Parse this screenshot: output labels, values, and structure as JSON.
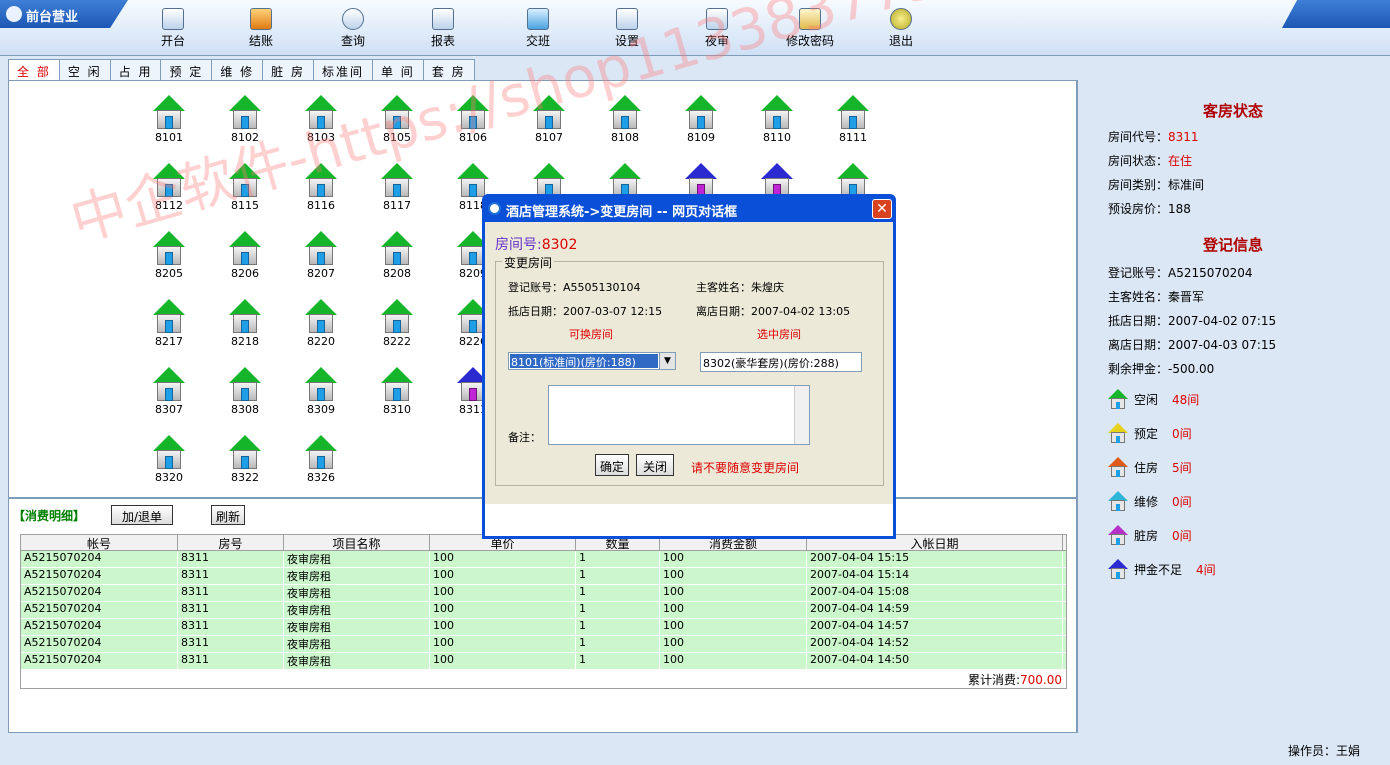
{
  "app": {
    "title": "前台营业"
  },
  "toolbar": {
    "buttons": [
      {
        "label": "开台"
      },
      {
        "label": "结账"
      },
      {
        "label": "查询"
      },
      {
        "label": "报表"
      },
      {
        "label": "交班"
      },
      {
        "label": "设置"
      },
      {
        "label": "夜审"
      },
      {
        "label": "修改密码"
      },
      {
        "label": "退出"
      }
    ]
  },
  "tabs": [
    "全 部",
    "空 闲",
    "占 用",
    "预 定",
    "维 修",
    "脏 房",
    "标准间",
    "单 间",
    "套 房"
  ],
  "rooms": [
    {
      "no": "8101",
      "s": "free"
    },
    {
      "no": "8102",
      "s": "free"
    },
    {
      "no": "8103",
      "s": "free"
    },
    {
      "no": "8105",
      "s": "free"
    },
    {
      "no": "8106",
      "s": "free"
    },
    {
      "no": "8107",
      "s": "free"
    },
    {
      "no": "8108",
      "s": "free"
    },
    {
      "no": "8109",
      "s": "free"
    },
    {
      "no": "8110",
      "s": "free"
    },
    {
      "no": "8111",
      "s": "free"
    },
    {
      "no": "8112",
      "s": "free"
    },
    {
      "no": "8115",
      "s": "free"
    },
    {
      "no": "8116",
      "s": "free"
    },
    {
      "no": "8117",
      "s": "free"
    },
    {
      "no": "8118",
      "s": "free"
    },
    {
      "no": "",
      "s": "free"
    },
    {
      "no": "",
      "s": "free"
    },
    {
      "no": "",
      "s": "dirty"
    },
    {
      "no": "",
      "s": "dirty"
    },
    {
      "no": "",
      "s": "free"
    },
    {
      "no": "8205",
      "s": "free"
    },
    {
      "no": "8206",
      "s": "free"
    },
    {
      "no": "8207",
      "s": "free"
    },
    {
      "no": "8208",
      "s": "free"
    },
    {
      "no": "8209",
      "s": "free"
    },
    {
      "no": "8217",
      "s": "free"
    },
    {
      "no": "8218",
      "s": "free"
    },
    {
      "no": "8220",
      "s": "free"
    },
    {
      "no": "8222",
      "s": "free"
    },
    {
      "no": "8226",
      "s": "free"
    },
    {
      "no": "8307",
      "s": "free"
    },
    {
      "no": "8308",
      "s": "free"
    },
    {
      "no": "8309",
      "s": "free"
    },
    {
      "no": "8310",
      "s": "free"
    },
    {
      "no": "8311",
      "s": "dirty"
    },
    {
      "no": "8320",
      "s": "free"
    },
    {
      "no": "8322",
      "s": "free"
    },
    {
      "no": "8326",
      "s": "free"
    }
  ],
  "room_status": {
    "title": "客房状态",
    "room_code_label": "房间代号：",
    "room_code": "8311",
    "status_label": "房间状态：",
    "status": "在住",
    "type_label": "房间类别：",
    "type": "标准间",
    "price_label": "预设房价：",
    "price": "188"
  },
  "register_info": {
    "title": "登记信息",
    "account": "登记账号：A5215070204",
    "guest": "主客姓名：秦晋军",
    "arrive": "抵店日期：2007-04-02 07:15",
    "leave": "离店日期：2007-04-03 07:15",
    "deposit": "剩余押金：-500.00"
  },
  "legend": [
    {
      "label": "空闲",
      "count": "48间",
      "color": "#15b52a"
    },
    {
      "label": "预定",
      "count": "0间",
      "color": "#e6d21a"
    },
    {
      "label": "住房",
      "count": "5间",
      "color": "#e05a1a"
    },
    {
      "label": "维修",
      "count": "0间",
      "color": "#2fb5d8"
    },
    {
      "label": "脏房",
      "count": "0间",
      "color": "#b530c8"
    },
    {
      "label": "押金不足",
      "count": "4间",
      "color": "#2a2ad0"
    }
  ],
  "consumption": {
    "label": "【消费明细】",
    "add_btn": "加/退单",
    "refresh_btn": "刷新",
    "headers": [
      "帐号",
      "房号",
      "项目名称",
      "单价",
      "数量",
      "消费金额",
      "入帐日期"
    ],
    "rows": [
      [
        "A5215070204",
        "8311",
        "夜审房租",
        "100",
        "1",
        "100",
        "2007-04-04 15:15"
      ],
      [
        "A5215070204",
        "8311",
        "夜审房租",
        "100",
        "1",
        "100",
        "2007-04-04 15:14"
      ],
      [
        "A5215070204",
        "8311",
        "夜审房租",
        "100",
        "1",
        "100",
        "2007-04-04 15:08"
      ],
      [
        "A5215070204",
        "8311",
        "夜审房租",
        "100",
        "1",
        "100",
        "2007-04-04 14:59"
      ],
      [
        "A5215070204",
        "8311",
        "夜审房租",
        "100",
        "1",
        "100",
        "2007-04-04 14:57"
      ],
      [
        "A5215070204",
        "8311",
        "夜审房租",
        "100",
        "1",
        "100",
        "2007-04-04 14:52"
      ],
      [
        "A5215070204",
        "8311",
        "夜审房租",
        "100",
        "1",
        "100",
        "2007-04-04 14:50"
      ]
    ],
    "total_label": "累计消费:",
    "total": "700.00"
  },
  "statusbar": {
    "operator": "操作员：王娟"
  },
  "dialog": {
    "title": "酒店管理系统->变更房间 -- 网页对话框",
    "room_label": "房间号:",
    "room_value": "8302",
    "group_title": "变更房间",
    "account": "登记账号：A5505130104",
    "guest": "主客姓名：朱煌庆",
    "arrive": "抵店日期：2007-03-07 12:15",
    "leave": "离店日期：2007-04-02 13:05",
    "available_label": "可换房间",
    "selected_label": "选中房间",
    "select_value": "8101(标准间)(房价:188)",
    "target_value": "8302(豪华套房)(房价:288)",
    "remark_label": "备注：",
    "ok_btn": "确定",
    "close_btn": "关闭",
    "warning": "请不要随意变更房间"
  },
  "watermark": "中企软件-https://shop113383775.taobao.com"
}
